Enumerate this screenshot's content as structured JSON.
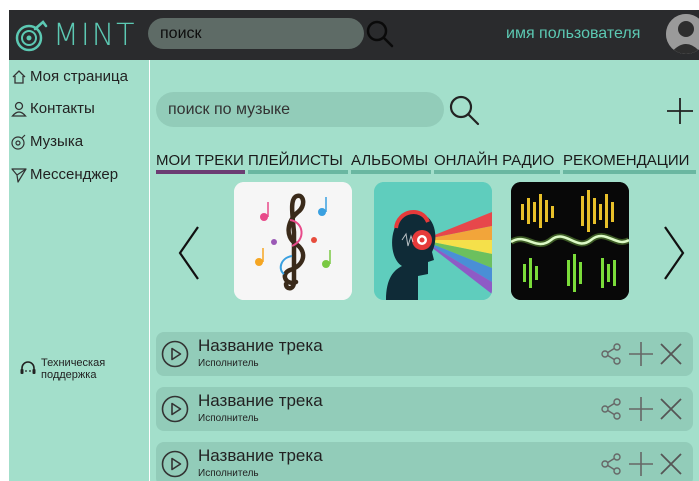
{
  "header": {
    "logo_text": "MINT",
    "search_placeholder": "поиск",
    "username": "имя пользователя"
  },
  "sidebar": {
    "items": [
      {
        "label": "Моя страница",
        "icon": "home-icon"
      },
      {
        "label": "Контакты",
        "icon": "person-icon"
      },
      {
        "label": "Музыка",
        "icon": "music-disc-icon"
      },
      {
        "label": "Мессенджер",
        "icon": "send-icon"
      }
    ],
    "support_label": "Техническая поддержка",
    "support_icon": "headset-icon"
  },
  "main": {
    "search_placeholder": "поиск по музыке",
    "tabs": [
      {
        "label": "МОИ ТРЕКИ",
        "active": true
      },
      {
        "label": "ПЛЕЙЛИСТЫ",
        "active": false
      },
      {
        "label": "АЛЬБОМЫ",
        "active": false
      },
      {
        "label": "ОНЛАЙН РАДИО",
        "active": false
      },
      {
        "label": "РЕКОМЕНДАЦИИ",
        "active": false
      }
    ],
    "albums": [
      {
        "icon": "treble-clef-art"
      },
      {
        "icon": "headphones-art"
      },
      {
        "icon": "sound-wave-art"
      }
    ],
    "tracks": [
      {
        "title": "Название трека",
        "artist": "Исполнитель"
      },
      {
        "title": "Название трека",
        "artist": "Исполнитель"
      },
      {
        "title": "Название трека",
        "artist": "Исполнитель"
      }
    ]
  },
  "colors": {
    "accent": "#5cc9b3",
    "topbar": "#2a2b2d",
    "background": "#a3dfcb",
    "card": "#92ccb9",
    "active_tab": "#6c3d73",
    "tab_underline": "#6ab7a1"
  }
}
